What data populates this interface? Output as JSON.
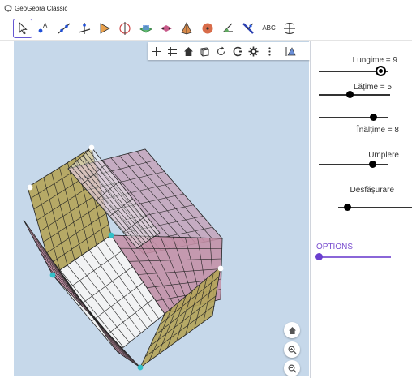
{
  "window": {
    "title": "GeoGebra Classic"
  },
  "toolbar": {
    "tools": [
      {
        "name": "move",
        "label": ""
      },
      {
        "name": "point",
        "label": ""
      },
      {
        "name": "line",
        "label": ""
      },
      {
        "name": "perpendicular",
        "label": ""
      },
      {
        "name": "intersect",
        "label": ""
      },
      {
        "name": "circle-axis",
        "label": ""
      },
      {
        "name": "plane",
        "label": ""
      },
      {
        "name": "pyramid",
        "label": ""
      },
      {
        "name": "sphere-tool",
        "label": ""
      },
      {
        "name": "angle",
        "label": ""
      },
      {
        "name": "reflect",
        "label": ""
      },
      {
        "name": "text",
        "label": "ABC"
      },
      {
        "name": "rotate-view",
        "label": ""
      }
    ]
  },
  "sliders": [
    {
      "id": "lungime",
      "label": "Lungime = 9",
      "value": 9
    },
    {
      "id": "latime",
      "label": "Lățime = 5",
      "value": 5
    },
    {
      "id": "inaltime",
      "label": "Înălțime = 8",
      "value": 8
    },
    {
      "id": "umplere",
      "label": "Umplere",
      "value": 0.75
    },
    {
      "id": "desfasurare",
      "label": "Desfășurare",
      "value": 0.15
    }
  ],
  "options": {
    "label": "OPTIONS",
    "value": 0
  },
  "colors": {
    "accent": "#6557d2",
    "graphics_bg": "#c6d8ea",
    "face_yellow": "#b4a55a",
    "face_pink": "#c48fa6",
    "face_white": "#f4f4f4",
    "vertex_cyan": "#33c0c8",
    "options_purple": "#7a4fd0"
  },
  "style_bar": {
    "icons": [
      "axes-icon",
      "grid-icon",
      "home-icon",
      "clipping-icon",
      "rotate-icon",
      "projection-icon",
      "settings-icon",
      "more-icon",
      "toggle-icon"
    ]
  },
  "zoom_controls": [
    "home-icon",
    "zoom-in-icon",
    "zoom-out-icon"
  ]
}
